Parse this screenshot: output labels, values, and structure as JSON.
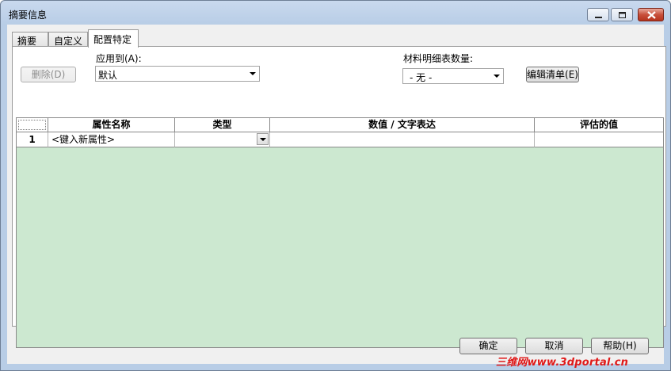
{
  "window": {
    "title": "摘要信息"
  },
  "tabs": [
    {
      "label": "摘要"
    },
    {
      "label": "自定义"
    },
    {
      "label": "配置特定"
    }
  ],
  "toolbar": {
    "delete_label": "删除(D)",
    "apply_to_label": "应用到(A):",
    "apply_to_value": "默认",
    "bom_qty_label": "材料明细表数量:",
    "bom_qty_value": "- 无 -",
    "edit_list_label": "编辑清单(E)"
  },
  "grid": {
    "headers": [
      "属性名称",
      "类型",
      "数值 / 文字表达",
      "评估的值"
    ],
    "rows": [
      {
        "num": "1",
        "name": "<键入新属性>",
        "type": "",
        "value": "",
        "evaluated": ""
      }
    ]
  },
  "footer": {
    "ok_label": "确定",
    "cancel_label": "取消",
    "help_label": "帮助(H)"
  },
  "watermark": "三维网www.3dportal.cn",
  "colors": {
    "grid_background": "#cce8d0",
    "title_bar": "#b8cde6",
    "close_button": "#c8503b"
  }
}
